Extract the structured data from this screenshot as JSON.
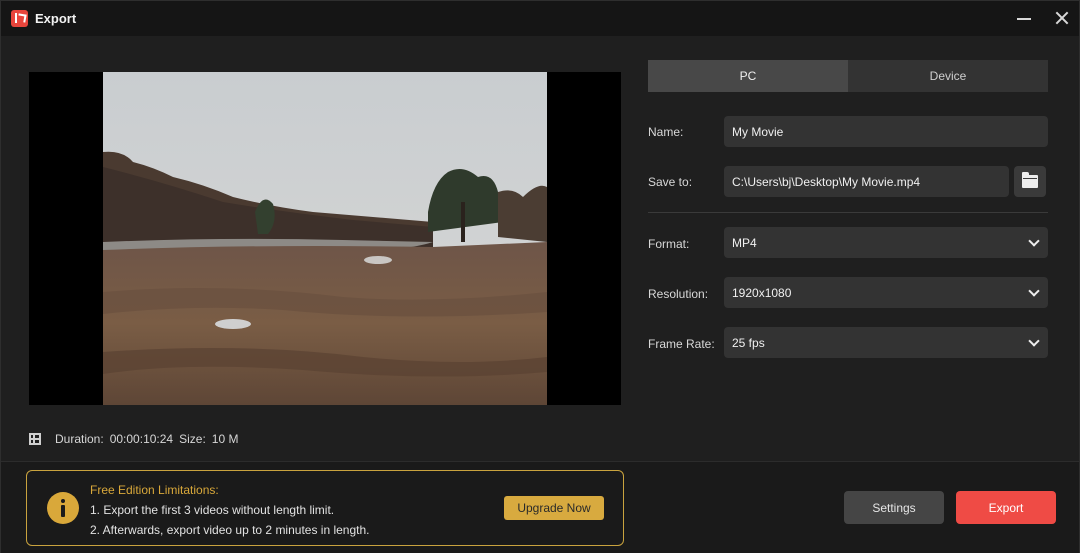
{
  "window": {
    "title": "Export",
    "app_icon": "app-logo-icon"
  },
  "preview": {
    "duration_label": "Duration:",
    "duration_value": "00:00:10:24",
    "size_label": "Size:",
    "size_value": "10 M"
  },
  "tabs": [
    {
      "label": "PC",
      "active": true
    },
    {
      "label": "Device",
      "active": false
    }
  ],
  "form": {
    "name_label": "Name:",
    "name_value": "My Movie",
    "save_label": "Save to:",
    "save_value": "C:\\Users\\bj\\Desktop\\My Movie.mp4",
    "format_label": "Format:",
    "format_value": "MP4",
    "resolution_label": "Resolution:",
    "resolution_value": "1920x1080",
    "framerate_label": "Frame Rate:",
    "framerate_value": "25 fps"
  },
  "limits": {
    "title": "Free Edition Limitations:",
    "line1": "1. Export the first 3 videos without length limit.",
    "line2": "2. Afterwards, export video up to 2 minutes in length.",
    "upgrade_label": "Upgrade Now"
  },
  "actions": {
    "settings_label": "Settings",
    "export_label": "Export"
  },
  "colors": {
    "accent": "#ef4b45",
    "warning": "#d9a83a",
    "background": "#1f1f1f"
  }
}
